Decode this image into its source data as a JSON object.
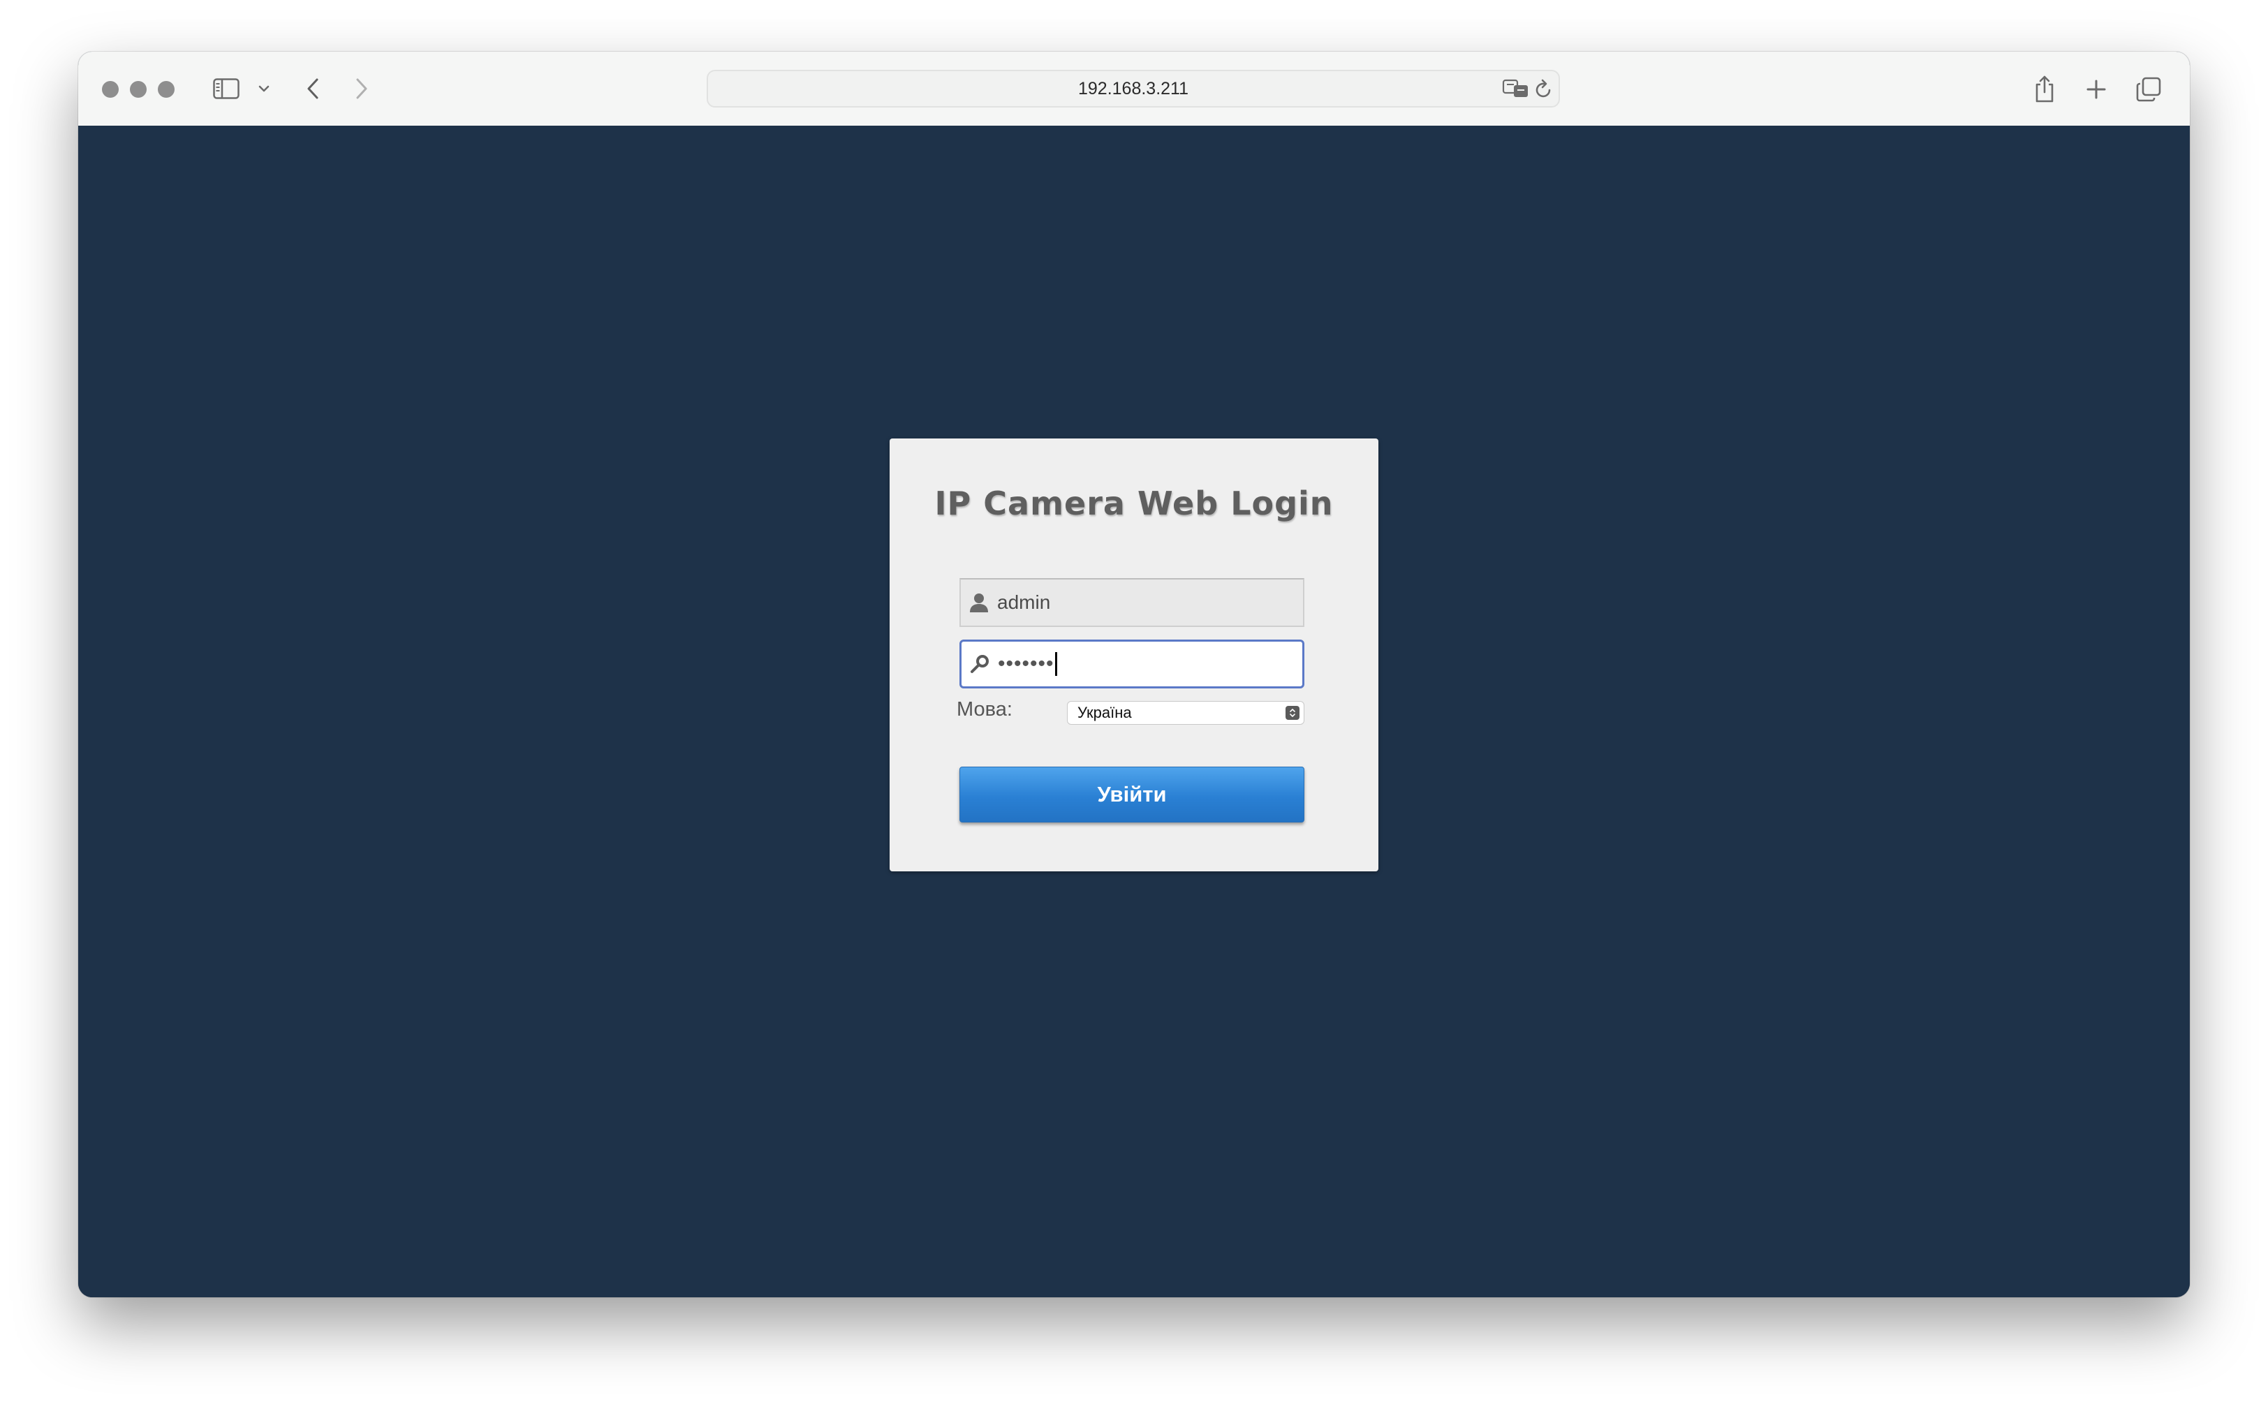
{
  "browser": {
    "url": "192.168.3.211"
  },
  "login": {
    "title": "IP Camera Web Login",
    "username_value": "admin",
    "password_masked": "•••••••",
    "language_label": "Мова:",
    "language_selected": "Україна",
    "submit_label": "Увійти"
  },
  "colors": {
    "page_background": "#1e3249",
    "panel_background": "#efefef",
    "button_blue": "#2a80d4",
    "focus_border": "#5b79c7"
  }
}
